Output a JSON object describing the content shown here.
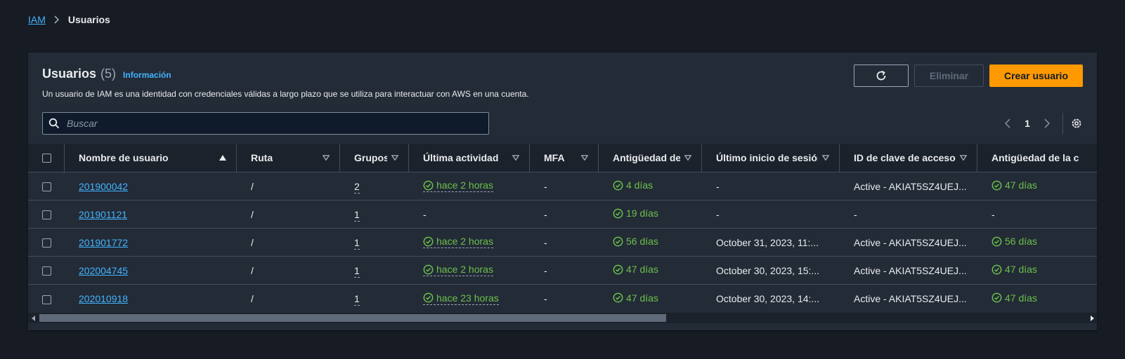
{
  "breadcrumb": {
    "root": "IAM",
    "current": "Usuarios"
  },
  "panel": {
    "title": "Usuarios",
    "count": "(5)",
    "info": "Información",
    "description": "Un usuario de IAM es una identidad con credenciales válidas a largo plazo que se utiliza para interactuar con AWS en una cuenta."
  },
  "actions": {
    "delete_label": "Eliminar",
    "create_label": "Crear usuario"
  },
  "search": {
    "placeholder": "Buscar"
  },
  "pagination": {
    "page": "1"
  },
  "table": {
    "headers": {
      "name": "Nombre de usuario",
      "path": "Ruta",
      "groups": "Grupos",
      "last_activity": "Última actividad",
      "mfa": "MFA",
      "age": "Antigüedad de",
      "last_login": "Último inicio de sesión",
      "access_key": "ID de clave de acceso",
      "key_age": "Antigüedad de la c"
    },
    "rows": [
      {
        "name": "201900042",
        "path": "/",
        "groups": "2",
        "last_activity": "hace 2 horas",
        "mfa": "-",
        "age": "4 días",
        "last_login": "-",
        "access_key": "Active - AKIAT5SZ4UEJ...",
        "key_age": "47 días"
      },
      {
        "name": "201901121",
        "path": "/",
        "groups": "1",
        "last_activity": "-",
        "mfa": "-",
        "age": "19 días",
        "last_login": "-",
        "access_key": "-",
        "key_age": "-"
      },
      {
        "name": "201901772",
        "path": "/",
        "groups": "1",
        "last_activity": "hace 2 horas",
        "mfa": "-",
        "age": "56 días",
        "last_login": "October 31, 2023, 11:...",
        "access_key": "Active - AKIAT5SZ4UEJ...",
        "key_age": "56 días"
      },
      {
        "name": "202004745",
        "path": "/",
        "groups": "1",
        "last_activity": "hace 2 horas",
        "mfa": "-",
        "age": "47 días",
        "last_login": "October 30, 2023, 15:...",
        "access_key": "Active - AKIAT5SZ4UEJ...",
        "key_age": "47 días"
      },
      {
        "name": "202010918",
        "path": "/",
        "groups": "1",
        "last_activity": "hace 23 horas",
        "mfa": "-",
        "age": "47 días",
        "last_login": "October 30, 2023, 14:...",
        "access_key": "Active - AKIAT5SZ4UEJ...",
        "key_age": "47 días"
      }
    ]
  },
  "icons": {
    "breadcrumb_separator": "chevron-right-icon",
    "refresh": "refresh-icon",
    "search": "search-icon",
    "page_prev": "chevron-left-icon",
    "page_next": "chevron-right-icon",
    "settings": "gear-icon",
    "status_ok": "check-circle-icon",
    "sort_asc": "caret-up-icon",
    "sort_filter": "caret-down-icon"
  },
  "colors": {
    "background": "#171b24",
    "panel": "#232b37",
    "link": "#42b4ff",
    "primary_button": "#ff9900",
    "success": "#6cc04a",
    "border": "#414d5c"
  }
}
